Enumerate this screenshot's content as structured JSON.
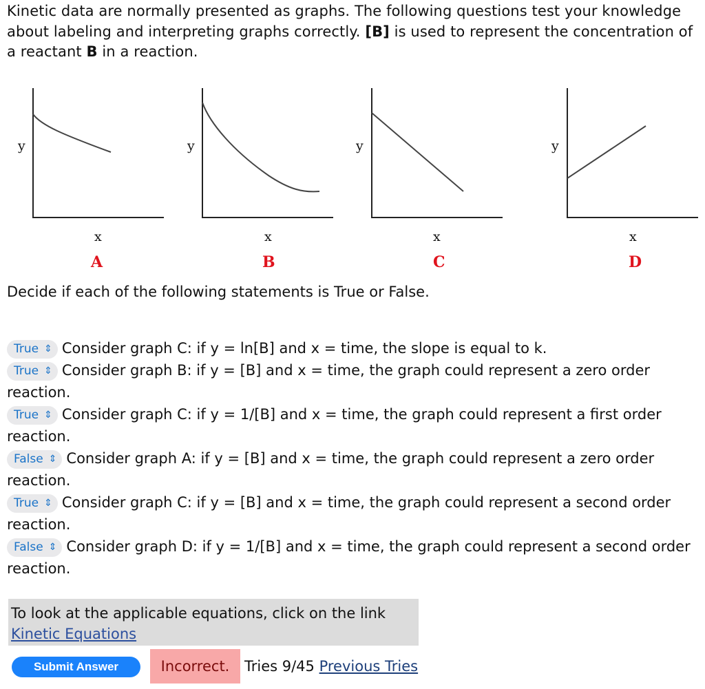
{
  "intro": {
    "part1": "Kinetic data are normally presented as graphs. The following questions test your knowledge about labeling and interpreting graphs correctly. ",
    "bold_b_bracket": "[B]",
    "part2": " is used to represent the concentration of a reactant ",
    "bold_b": "B",
    "part3": " in a reaction."
  },
  "graphs": [
    {
      "label": "A",
      "x_axis": "x",
      "y_axis": "y",
      "shape": "gentle decreasing curve"
    },
    {
      "label": "B",
      "x_axis": "x",
      "y_axis": "y",
      "shape": "steep decreasing curve"
    },
    {
      "label": "C",
      "x_axis": "x",
      "y_axis": "y",
      "shape": "decreasing straight line"
    },
    {
      "label": "D",
      "x_axis": "x",
      "y_axis": "y",
      "shape": "increasing straight line"
    }
  ],
  "graph_label_color": "#e0141e",
  "instruction": "Decide if each of the following statements is True or False.",
  "questions": [
    {
      "selected": "True",
      "text": "Consider graph C: if y = ln[B] and x = time, the slope is equal to k."
    },
    {
      "selected": "True",
      "text": "Consider graph B: if y = [B] and x = time, the graph could represent a zero order reaction."
    },
    {
      "selected": "True",
      "text": "Consider graph C: if y = 1/[B] and x = time, the graph could represent a first order reaction."
    },
    {
      "selected": "False",
      "text": "Consider graph A: if y = [B] and x = time, the graph could represent a zero order reaction."
    },
    {
      "selected": "True",
      "text": "Consider graph C: if y = [B] and x = time, the graph could represent a second order reaction."
    },
    {
      "selected": "False",
      "text": "Consider graph D: if y = 1/[B] and x = time, the graph could represent a second order reaction."
    }
  ],
  "equations_box": {
    "text": "To look at the applicable equations, click on the link",
    "link": "Kinetic Equations"
  },
  "footer": {
    "submit_label": "Submit Answer",
    "status": "Incorrect.",
    "tries": "Tries 9/45",
    "previous_tries_link": "Previous Tries"
  },
  "colors": {
    "submit": "#1a82fb",
    "incorrect_bg": "#f8a8a8",
    "incorrect_text": "#7a0c0c",
    "select_text": "#1a73c8"
  }
}
